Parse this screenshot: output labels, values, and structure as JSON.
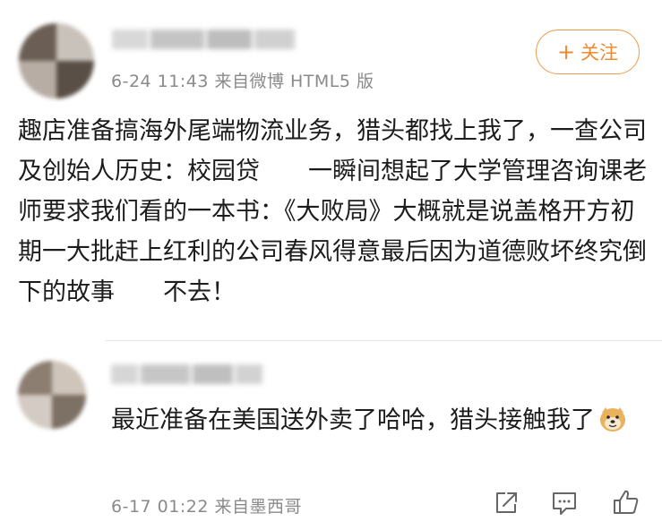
{
  "post": {
    "time_source": "6-24 11:43  来自微博 HTML5 版",
    "follow_label": "关注",
    "follow_plus": "+",
    "text": "趣店准备搞海外尾端物流业务，猎头都找上我了，一查公司及创始人历史：校园贷　　一瞬间想起了大学管理咨询课老师要求我们看的一本书：《大败局》大概就是说盖格开方初期一大批赶上红利的公司春风得意最后因为道德败坏终究倒下的故事　　不去！"
  },
  "reply": {
    "text": "最近准备在美国送外卖了哈哈，猎头接触我了",
    "emoji": "doge-emoji",
    "time_source": "6-17 01:22  来自墨西哥"
  },
  "icons": {
    "share": "share-icon",
    "comment": "comment-icon",
    "like": "thumbs-up-icon"
  },
  "colors": {
    "accent": "#f08a32",
    "meta_text": "#8a8a8a",
    "body_text": "#1c1c1c"
  }
}
